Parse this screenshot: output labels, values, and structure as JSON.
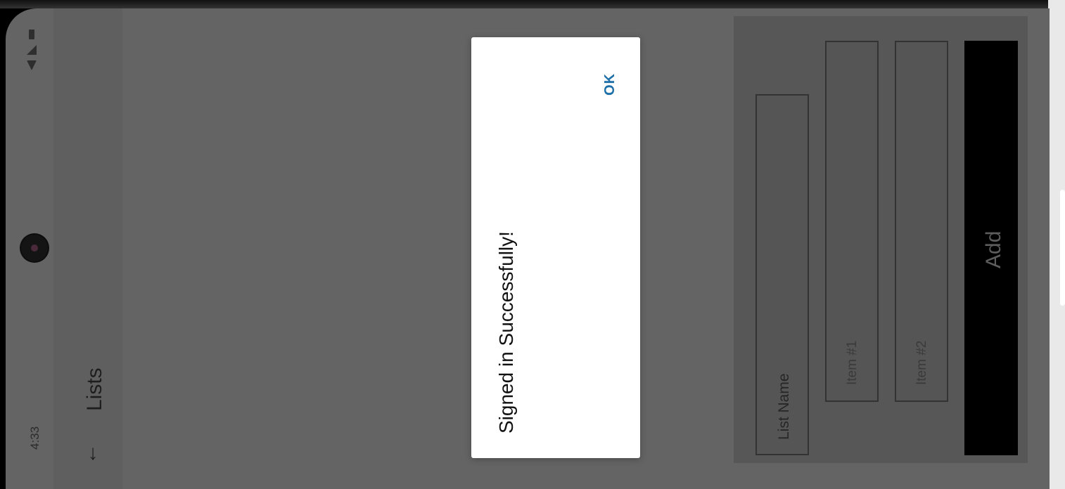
{
  "status_bar": {
    "time": "4:33",
    "icons": [
      "notification-icon",
      "no-sim-icon",
      "wifi-icon",
      "signal-icon",
      "battery-icon"
    ]
  },
  "app_bar": {
    "title": "Lists",
    "back_icon": "arrow-back-icon"
  },
  "form": {
    "list_name_placeholder": "List Name",
    "item1_placeholder": "Item #1",
    "item2_placeholder": "Item #2",
    "add_label": "Add"
  },
  "dialog": {
    "message": "Signed in Successfully!",
    "ok_label": "OK"
  },
  "colors": {
    "scrim": "#646464",
    "dialog_bg": "#ffffff",
    "accent": "#1e6fa8",
    "button_bg": "#000000"
  }
}
